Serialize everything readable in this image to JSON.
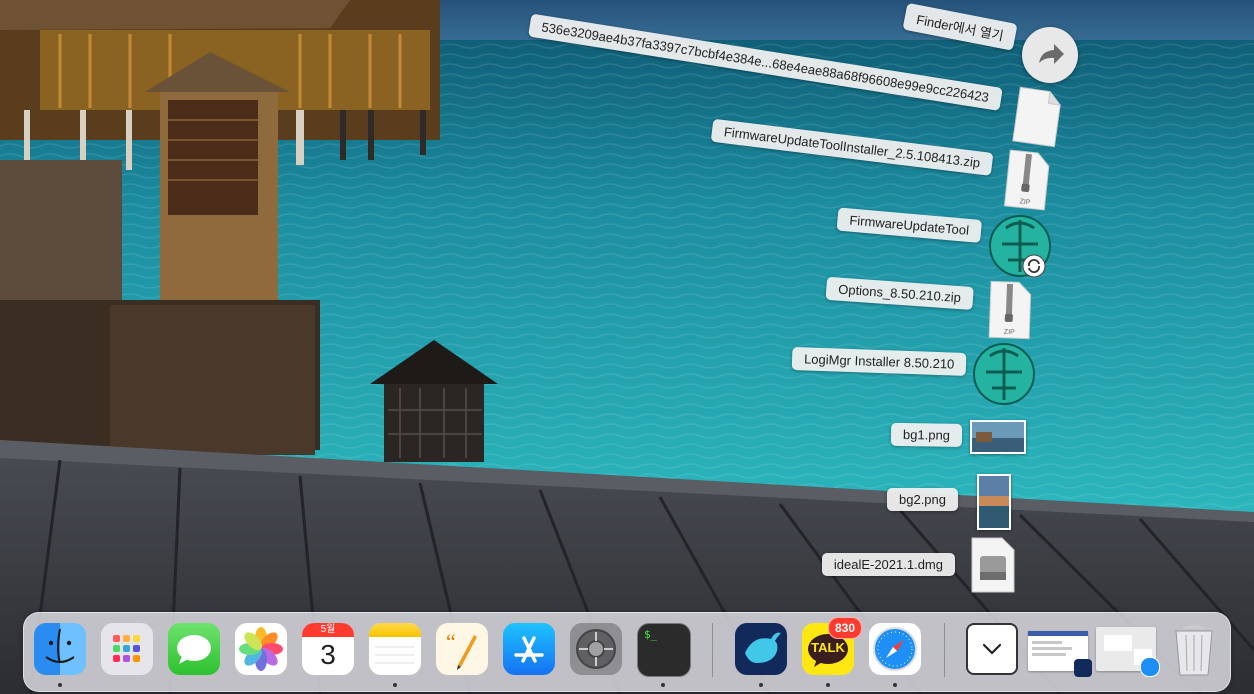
{
  "stack": {
    "open_in_finder": "Finder에서 열기",
    "items": [
      {
        "label": "536e3209ae4b37fa3397c7bcbf4e384e...68e4eae88a68f96608e99e9cc226423",
        "icon": "document-icon"
      },
      {
        "label": "FirmwareUpdateToolInstaller_2.5.108413.zip",
        "icon": "zip-icon"
      },
      {
        "label": "FirmwareUpdateTool",
        "icon": "logitech-update-icon"
      },
      {
        "label": "Options_8.50.210.zip",
        "icon": "zip-icon"
      },
      {
        "label": "LogiMgr Installer 8.50.210",
        "icon": "logitech-installer-icon"
      },
      {
        "label": "bg1.png",
        "icon": "image-thumbnail-icon"
      },
      {
        "label": "bg2.png",
        "icon": "image-thumbnail-icon"
      },
      {
        "label": "idealE-2021.1.dmg",
        "icon": "disk-image-icon"
      }
    ],
    "zip_tag": "ZIP"
  },
  "dock": {
    "apps": [
      {
        "name": "Finder",
        "icon": "finder-icon",
        "running": true
      },
      {
        "name": "Launchpad",
        "icon": "launchpad-icon",
        "running": false
      },
      {
        "name": "Messages",
        "icon": "messages-icon",
        "running": false
      },
      {
        "name": "Photos",
        "icon": "photos-icon",
        "running": false
      },
      {
        "name": "Calendar",
        "icon": "calendar-icon",
        "running": false,
        "month": "5월",
        "day": "3"
      },
      {
        "name": "Notes",
        "icon": "notes-icon",
        "running": true
      },
      {
        "name": "Pages",
        "icon": "pages-icon",
        "running": false
      },
      {
        "name": "App Store",
        "icon": "app-store-icon",
        "running": false
      },
      {
        "name": "System Preferences",
        "icon": "system-preferences-icon",
        "running": false
      },
      {
        "name": "Terminal",
        "icon": "terminal-icon",
        "running": true,
        "prompt": "$_"
      },
      {
        "name": "Whale",
        "icon": "whale-browser-icon",
        "running": true
      },
      {
        "name": "KakaoTalk",
        "icon": "kakaotalk-icon",
        "running": true,
        "badge": "830",
        "text": "TALK"
      },
      {
        "name": "Safari",
        "icon": "safari-icon",
        "running": true
      },
      {
        "name": "Downloads",
        "icon": "downloads-stack-icon",
        "running": false
      },
      {
        "name": "Window 1",
        "icon": "minimized-window-icon",
        "running": false
      },
      {
        "name": "Window 2",
        "icon": "minimized-window-icon",
        "running": false
      },
      {
        "name": "Trash",
        "icon": "trash-icon",
        "running": false
      }
    ]
  },
  "colors": {
    "sea": "#1f9aa6",
    "sky": "#3d6f93",
    "deck": "#3b3e44",
    "kakao": "#ffe812",
    "badge": "#ff3b30"
  }
}
